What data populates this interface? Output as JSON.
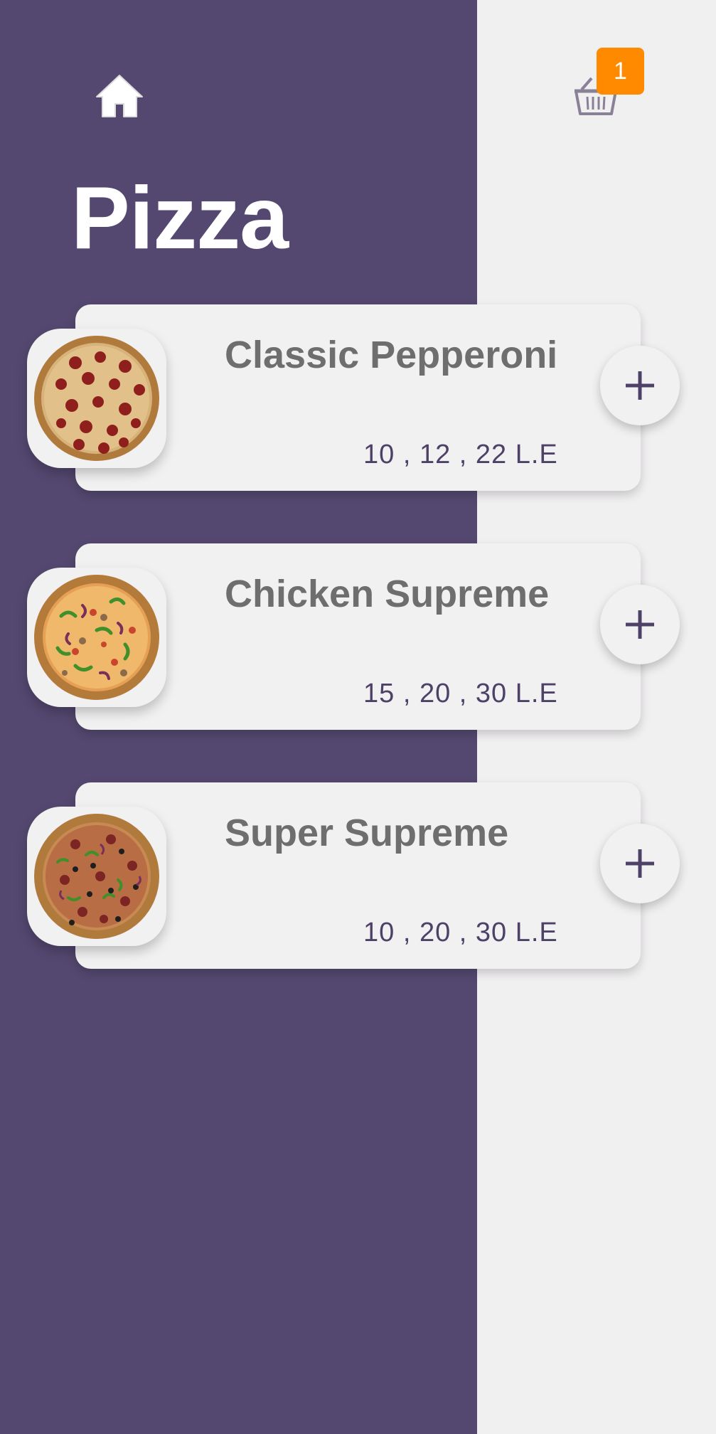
{
  "header": {
    "home_icon": "home-icon",
    "cart_icon": "basket-icon",
    "cart_count": "1",
    "badge_color": "#ff8a00"
  },
  "title": "Pizza",
  "colors": {
    "panel": "#544870",
    "background": "#f1f0f1",
    "card": "#f2f1f2",
    "name_text": "#6e6e6e",
    "price_text": "#4d4168",
    "add_icon": "#4d4168"
  },
  "products": [
    {
      "name": "Classic Pepperoni",
      "price": "10 , 12 , 22 L.E",
      "image": "pepperoni-pizza-image",
      "add_icon": "plus-icon"
    },
    {
      "name": "Chicken Supreme",
      "price": "15 , 20 , 30 L.E",
      "image": "chicken-supreme-pizza-image",
      "add_icon": "plus-icon"
    },
    {
      "name": "Super Supreme",
      "price": "10 , 20 , 30 L.E",
      "image": "super-supreme-pizza-image",
      "add_icon": "plus-icon"
    }
  ]
}
